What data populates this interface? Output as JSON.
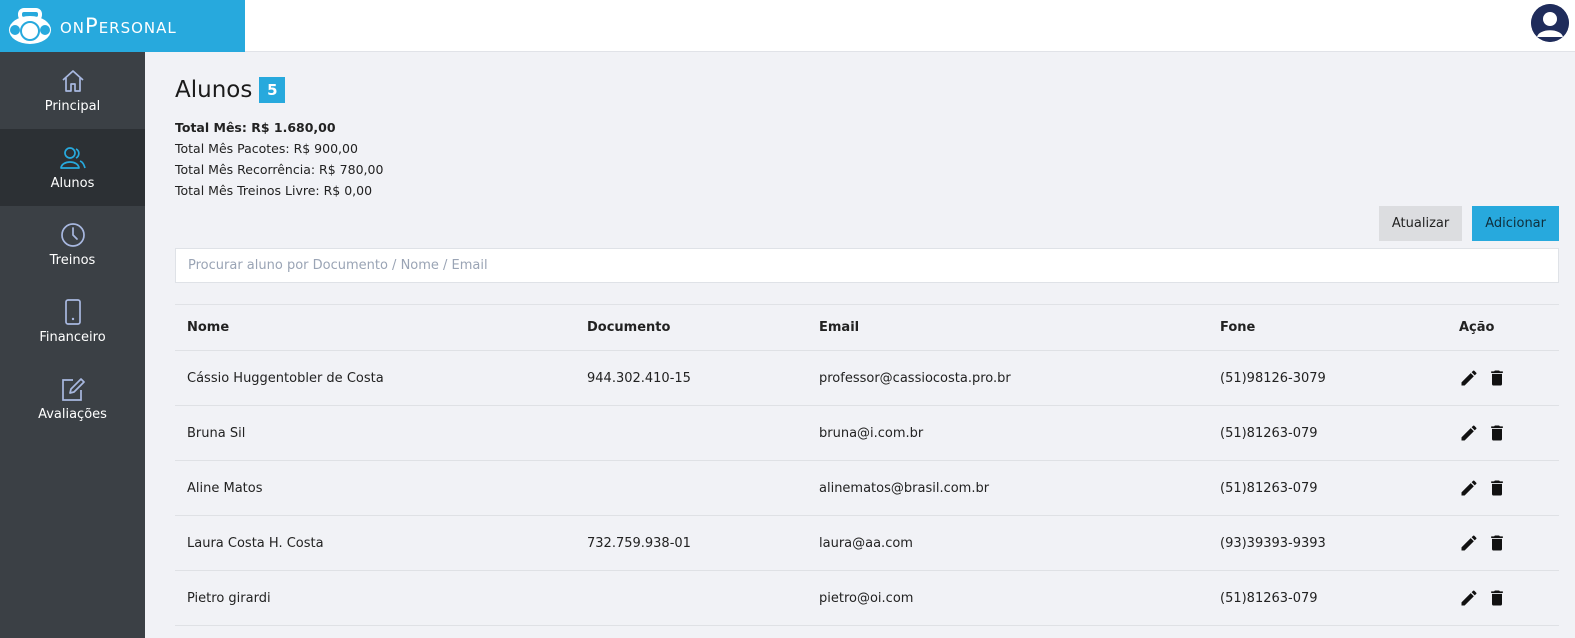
{
  "brand": {
    "name": "onPersonal"
  },
  "colors": {
    "accent": "#27a9dd",
    "sidebar": "#3b4045",
    "sidebar_active": "#2c3034",
    "background": "#f1f2f6"
  },
  "sidebar": {
    "items": [
      {
        "label": "Principal",
        "icon": "home-icon"
      },
      {
        "label": "Alunos",
        "icon": "users-icon",
        "active": true
      },
      {
        "label": "Treinos",
        "icon": "clock-icon"
      },
      {
        "label": "Financeiro",
        "icon": "tablet-icon"
      },
      {
        "label": "Avaliações",
        "icon": "edit-icon"
      }
    ]
  },
  "page": {
    "title": "Alunos",
    "count": "5",
    "totals": {
      "total_mes": "Total Mês: R$ 1.680,00",
      "pacotes": "Total Mês Pacotes: R$ 900,00",
      "recorrencia": "Total Mês Recorrência: R$ 780,00",
      "treinos_livre": "Total Mês Treinos Livre: R$ 0,00"
    }
  },
  "actions": {
    "refresh_label": "Atualizar",
    "add_label": "Adicionar"
  },
  "search": {
    "placeholder": "Procurar aluno por Documento / Nome / Email",
    "value": ""
  },
  "table": {
    "columns": [
      "Nome",
      "Documento",
      "Email",
      "Fone",
      "Ação"
    ],
    "rows": [
      {
        "nome": "Cássio Huggentobler de Costa",
        "documento": "944.302.410-15",
        "email": "professor@cassiocosta.pro.br",
        "fone": "(51)98126-3079"
      },
      {
        "nome": "Bruna Sil",
        "documento": "",
        "email": "bruna@i.com.br",
        "fone": "(51)81263-079"
      },
      {
        "nome": "Aline Matos",
        "documento": "",
        "email": "alinematos@brasil.com.br",
        "fone": "(51)81263-079"
      },
      {
        "nome": "Laura Costa H. Costa",
        "documento": "732.759.938-01",
        "email": "laura@aa.com",
        "fone": "(93)39393-9393"
      },
      {
        "nome": "Pietro girardi",
        "documento": "",
        "email": "pietro@oi.com",
        "fone": "(51)81263-079"
      }
    ]
  }
}
